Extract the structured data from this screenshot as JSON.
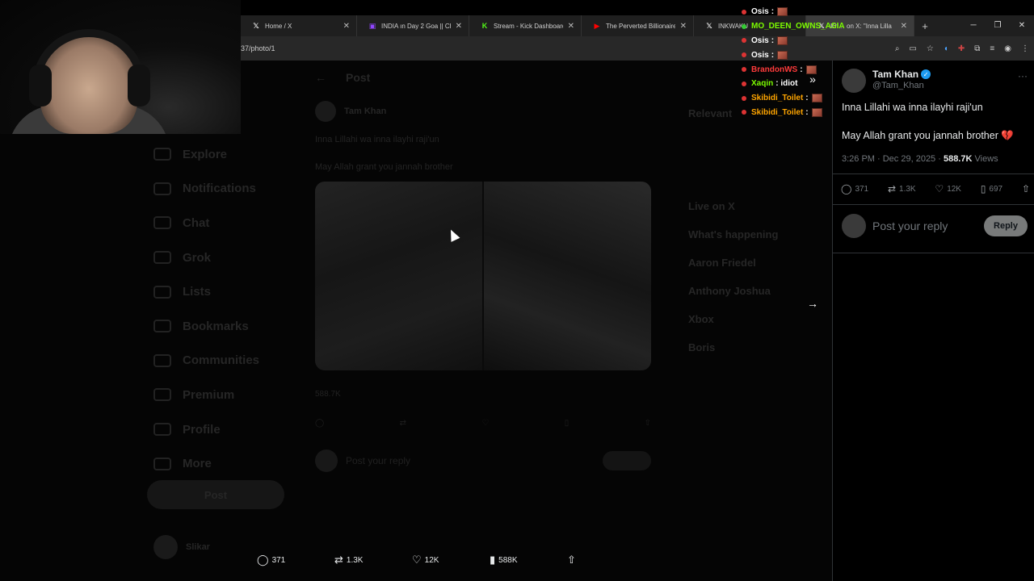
{
  "browser": {
    "tabs": [
      {
        "label": "Home / X",
        "icon": "x-logo-icon",
        "icon_glyph": "𝕏",
        "icon_color": "#ffffff"
      },
      {
        "label": "INDIA ın Day 2 Goa || Cha",
        "icon": "twitch-icon",
        "icon_glyph": "▣",
        "icon_color": "#9146ff"
      },
      {
        "label": "Stream - Kick Dashboard",
        "icon": "kick-icon",
        "icon_glyph": "K",
        "icon_color": "#53fc18"
      },
      {
        "label": "The Perverted Billionaire",
        "icon": "youtube-icon",
        "icon_glyph": "▶",
        "icon_color": "#ff0000"
      },
      {
        "label": "INKWAKU",
        "icon": "x-logo-icon",
        "icon_glyph": "𝕏",
        "icon_color": "#ffffff"
      },
      {
        "label": "Kh… on X: \"Inna Lilla",
        "icon": "x-logo-icon",
        "icon_glyph": "𝕏",
        "icon_color": "#ffffff",
        "active": true
      }
    ],
    "new_tab": "+",
    "url": "37/photo/1"
  },
  "chat": [
    {
      "user": "Osis",
      "color": "#ffffff",
      "msg": ":",
      "emote": true
    },
    {
      "user": "MO_DEEN_OWNS_ASIA",
      "color": "#7cfc00",
      "msg": "",
      "emote": false
    },
    {
      "user": "Osis",
      "color": "#ffffff",
      "msg": ":",
      "emote": true
    },
    {
      "user": "Osis",
      "color": "#ffffff",
      "msg": ":",
      "emote": true
    },
    {
      "user": "BrandonWS",
      "color": "#ff3b3b",
      "msg": ":",
      "emote": true
    },
    {
      "user": "Xaqin",
      "color": "#7cfc00",
      "msg": ": idiot",
      "emote": false
    },
    {
      "user": "Skibidi_Toilet",
      "color": "#ffa500",
      "msg": ":",
      "emote": true
    },
    {
      "user": "Skibidi_Toilet",
      "color": "#ffa500",
      "msg": ":",
      "emote": true
    }
  ],
  "background_page": {
    "header": "Post",
    "nav": [
      "Explore",
      "Notifications",
      "Chat",
      "Grok",
      "Lists",
      "Bookmarks",
      "Communities",
      "Premium",
      "Profile",
      "More"
    ],
    "post_button": "Post",
    "author": "Tam Khan",
    "text1": "Inna Lillahi wa inna ilayhi raji'un",
    "text2": "May Allah grant you jannah brother",
    "views": "588.7K",
    "reply_placeholder": "Post your reply",
    "right_sections": [
      "Relevant",
      "Live on X",
      "What's happening"
    ],
    "trends": [
      "Aaron Friedel",
      "Anthony Joshua",
      "Xbox",
      "Boris"
    ],
    "user_name": "Slikar"
  },
  "tweet": {
    "name": "Tam Khan",
    "handle": "@Tam_Khan",
    "text1": "Inna Lillahi wa inna ilayhi raji'un",
    "text2": "May Allah grant you jannah brother",
    "heart_emoji": "💔",
    "time": "3:26 PM · Dec 29, 2025 · ",
    "views_count": "588.7K",
    "views_label": " Views",
    "replies": "371",
    "reposts": "1.3K",
    "likes": "12K",
    "bookmarks": "697",
    "reply_placeholder": "Post your reply",
    "reply_button": "Reply",
    "more": "···"
  },
  "photo_bar": {
    "replies": "371",
    "reposts": "1.3K",
    "likes": "12K",
    "views": "588K"
  }
}
